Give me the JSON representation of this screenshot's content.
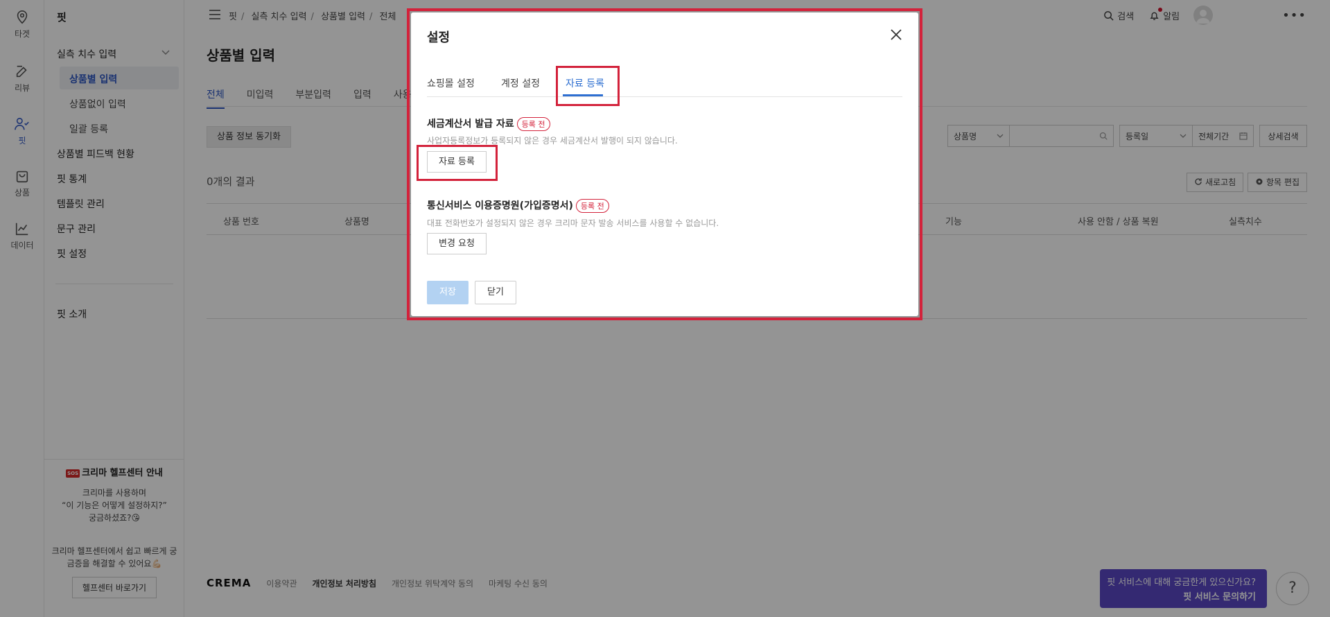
{
  "rail": {
    "items": [
      {
        "label": "타겟",
        "icon": "location-pin-icon"
      },
      {
        "label": "리뷰",
        "icon": "edit-icon"
      },
      {
        "label": "핏",
        "icon": "user-check-icon"
      },
      {
        "label": "상품",
        "icon": "bag-icon"
      },
      {
        "label": "데이터",
        "icon": "chart-line-icon"
      }
    ]
  },
  "sidebar": {
    "title": "핏",
    "group": "실측 치수 입력",
    "sub_items": [
      "상품별 입력",
      "상품없이 입력",
      "일괄 등록"
    ],
    "items": [
      "상품별 피드백 현황",
      "핏 통계",
      "템플릿 관리",
      "문구 관리",
      "핏 설정"
    ],
    "intro": "핏 소개"
  },
  "help": {
    "badge": "SOS",
    "title": "크리마 헬프센터 안내",
    "line1": "크리마를 사용하며",
    "line2": "“이 기능은 어떻게 설정하지?”",
    "line3": "궁금하셨죠?😘",
    "line4": "크리마 헬프센터에서 쉽고 빠르게 궁금증을 해결할 수 있어요💪🏻",
    "button": "헬프센터 바로가기"
  },
  "breadcrumb": [
    "핏",
    "실측 치수 입력",
    "상품별 입력",
    "전체"
  ],
  "topbar": {
    "search": "검색",
    "alerts": "알림",
    "more": "•••"
  },
  "page": {
    "title": "상품별 입력",
    "tabs": [
      "전체",
      "미입력",
      "부분입력",
      "입력",
      "사용"
    ],
    "sync_button": "상품 정보 동기화",
    "filters": {
      "field_select": "상품명",
      "search_placeholder": "",
      "date_select": "등록일",
      "period": "전체기간",
      "advanced": "상세검색"
    },
    "result_count": "0개의 결과",
    "refresh": "새로고침",
    "edit_columns": "항목 편집",
    "columns": [
      "상품 번호",
      "상품명",
      "기능",
      "사용 안함 / 상품 복원",
      "실측치수"
    ]
  },
  "footer": {
    "logo": "CREMA",
    "links": [
      "이용약관",
      "개인정보 처리방침",
      "개인정보 위탁계약 동의",
      "마케팅 수신 동의"
    ]
  },
  "chat": {
    "line1": "핏 서비스에 대해 궁금한게 있으신가요?",
    "line2": "핏 서비스 문의하기",
    "help_symbol": "?"
  },
  "modal": {
    "title": "설정",
    "tabs": [
      "쇼핑몰 설정",
      "계정 설정",
      "자료 등록"
    ],
    "active_tab": 2,
    "sections": [
      {
        "title": "세금계산서 발급 자료",
        "badge": "등록 전",
        "desc": "사업자등록정보가 등록되지 않은 경우 세금계산서 발행이 되지 않습니다.",
        "button": "자료 등록"
      },
      {
        "title": "통신서비스 이용증명원(가입증명서)",
        "badge": "등록 전",
        "desc": "대표 전화번호가 설정되지 않은 경우 크리마 문자 발송 서비스를 사용할 수 없습니다.",
        "button": "변경 요청"
      }
    ],
    "save": "저장",
    "close": "닫기"
  },
  "colors": {
    "accent": "#2e57c3",
    "highlight": "#d3223b",
    "chat": "#5a48c4",
    "save_disabled": "#b3d2f2"
  }
}
